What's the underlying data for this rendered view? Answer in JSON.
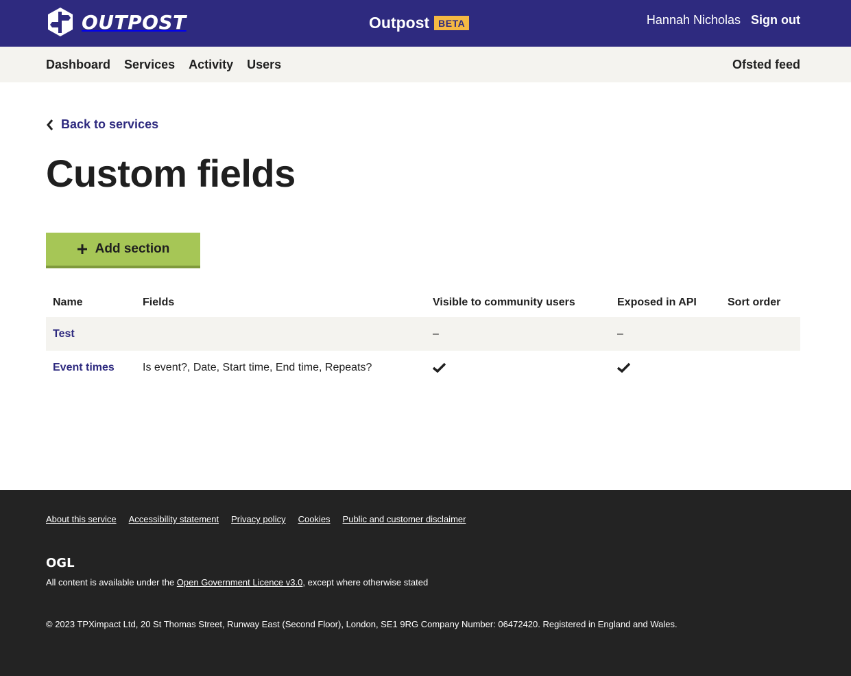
{
  "header": {
    "brand": "OUTPOST",
    "service_title": "Outpost",
    "beta_tag": "BETA",
    "user_name": "Hannah Nicholas",
    "sign_out": "Sign out",
    "colors": {
      "primary": "#2e2a7f",
      "beta": "#f5b843"
    }
  },
  "nav": {
    "items": [
      "Dashboard",
      "Services",
      "Activity",
      "Users"
    ],
    "right": "Ofsted feed"
  },
  "back_link": "Back to services",
  "page_title": "Custom fields",
  "add_button": {
    "label": "Add section",
    "color": "#a6c656"
  },
  "table": {
    "columns": [
      "Name",
      "Fields",
      "Visible to community users",
      "Exposed in API",
      "Sort order"
    ],
    "rows": [
      {
        "name": "Test",
        "fields": "",
        "visible": "–",
        "exposed": "–",
        "sort_order": ""
      },
      {
        "name": "Event times",
        "fields": "Is event?, Date, Start time, End time, Repeats?",
        "visible": "check-icon",
        "exposed": "check-icon",
        "sort_order": ""
      }
    ]
  },
  "footer": {
    "links": [
      "About this service",
      "Accessibility statement",
      "Privacy policy",
      "Cookies",
      "Public and customer disclaimer"
    ],
    "ogl_logo": "OGL",
    "licence_prefix": "All content is available under the ",
    "licence_link": "Open Government Licence v3.0",
    "licence_suffix": ", except where otherwise stated",
    "copyright": "© 2023 TPXimpact Ltd, 20 St Thomas Street, Runway East (Second Floor), London, SE1 9RG Company Number: 06472420. Registered in England and Wales."
  }
}
